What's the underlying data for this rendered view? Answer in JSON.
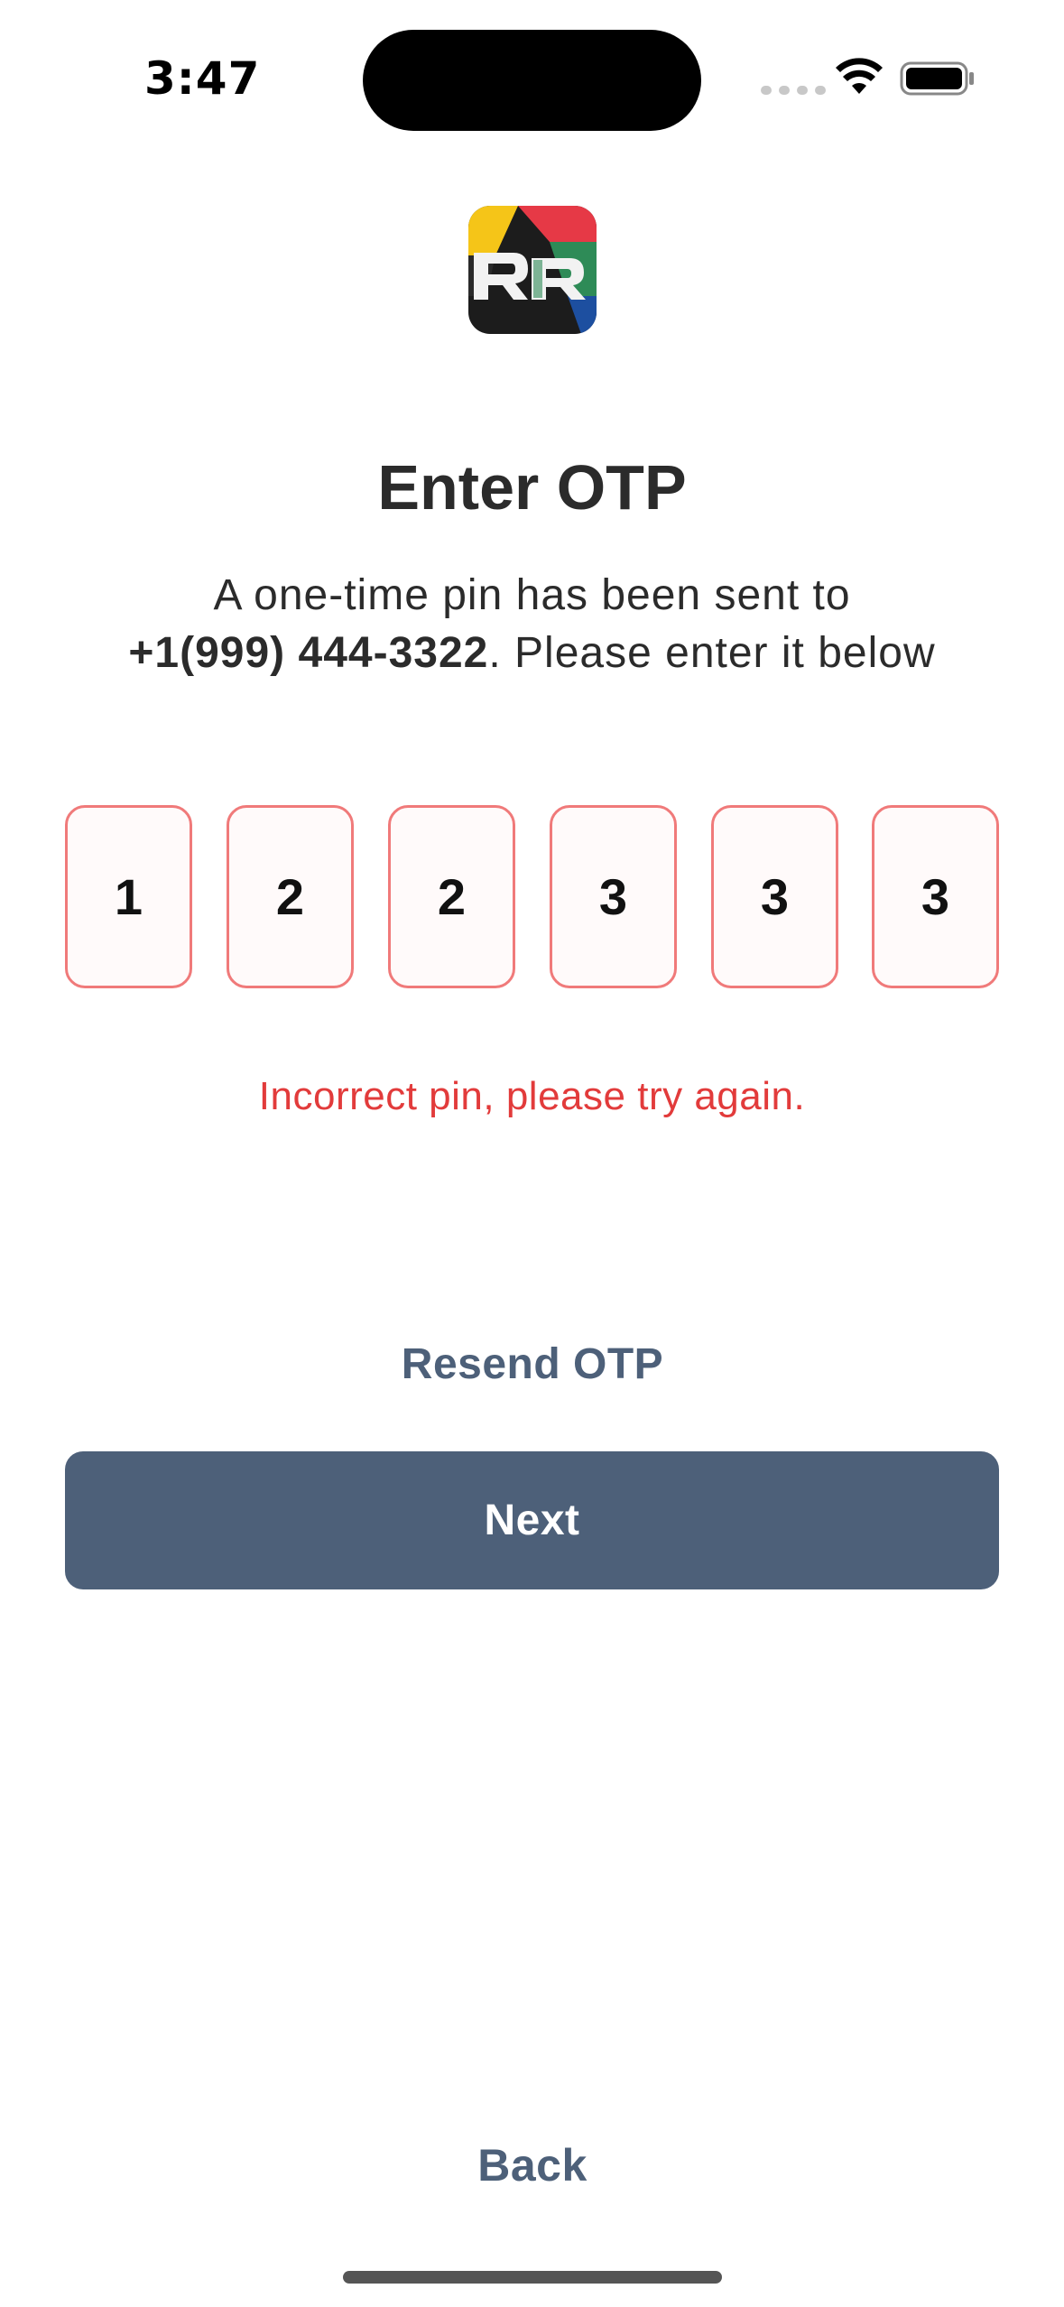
{
  "status_bar": {
    "time": "3:47"
  },
  "logo": {
    "icon": "rr-app-logo",
    "colors": [
      "#f5c518",
      "#e63946",
      "#2e8b57",
      "#1d4fa0",
      "#1c1c1c"
    ]
  },
  "header": {
    "title": "Enter OTP",
    "subtitle_line1": "A one-time pin has been sent to",
    "phone": "+1(999) 444-3322",
    "subtitle_line2_suffix": ". Please enter it below"
  },
  "otp": {
    "digits": [
      "1",
      "2",
      "2",
      "3",
      "3",
      "3"
    ]
  },
  "error_message": "Incorrect pin, please try again.",
  "actions": {
    "resend_label": "Resend OTP",
    "next_label": "Next",
    "back_label": "Back"
  },
  "colors": {
    "accent": "#4d6079",
    "error": "#e23b3b",
    "otp_border": "#f07a7a"
  }
}
